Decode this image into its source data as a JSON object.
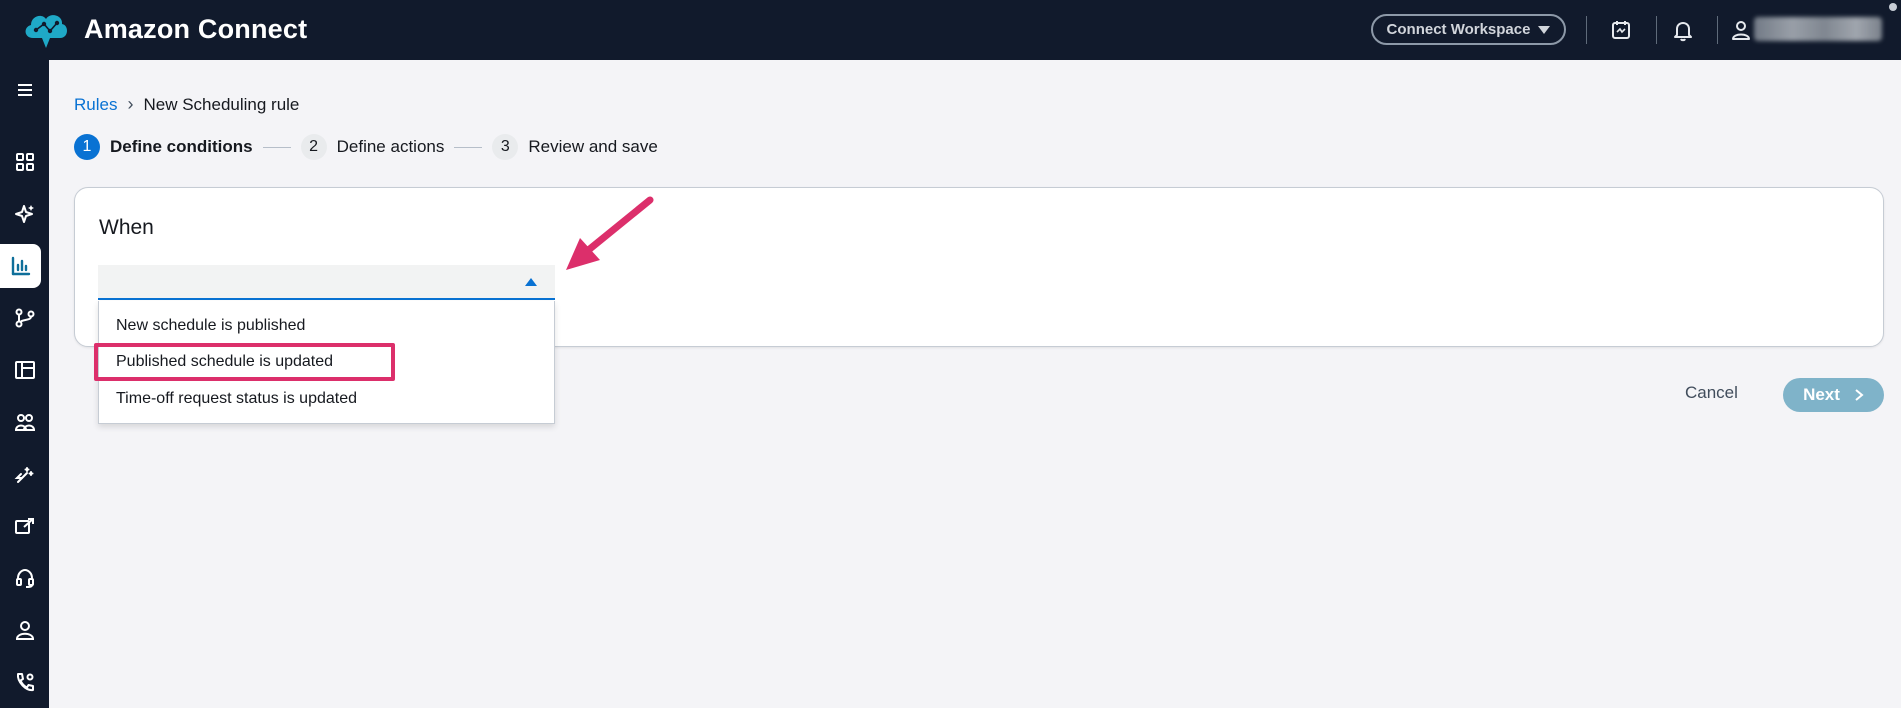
{
  "header": {
    "app_title": "Amazon Connect",
    "workspace_button": "Connect Workspace",
    "icons": [
      "calendar-icon",
      "bell-icon",
      "user-icon"
    ],
    "user_name_blurred": true
  },
  "sidenav": {
    "items": [
      {
        "icon": "menu-icon"
      },
      {
        "icon": "dashboard-grid-icon"
      },
      {
        "icon": "sparkle-ai-icon"
      },
      {
        "icon": "analytics-chart-icon",
        "active": true
      },
      {
        "icon": "routing-branch-icon"
      },
      {
        "icon": "table-layout-icon"
      },
      {
        "icon": "users-group-icon"
      },
      {
        "icon": "wand-icon"
      },
      {
        "icon": "export-icon"
      },
      {
        "icon": "headset-icon"
      },
      {
        "icon": "person-icon"
      },
      {
        "icon": "phone-settings-icon"
      }
    ]
  },
  "breadcrumb": {
    "link": "Rules",
    "current": "New Scheduling rule"
  },
  "steps": [
    {
      "num": "1",
      "label": "Define conditions",
      "active": true
    },
    {
      "num": "2",
      "label": "Define actions",
      "active": false
    },
    {
      "num": "3",
      "label": "Review and save",
      "active": false
    }
  ],
  "card": {
    "title": "When"
  },
  "select": {
    "value": "",
    "options": [
      "New schedule is published",
      "Published schedule is updated",
      "Time-off request status is updated"
    ],
    "highlighted_index": 1
  },
  "footer": {
    "cancel": "Cancel",
    "next": "Next"
  },
  "colors": {
    "topbar": "#111a2c",
    "accent": "#0972d3",
    "highlight": "#dc2f6b",
    "next_disabled": "#7fb3c9"
  }
}
